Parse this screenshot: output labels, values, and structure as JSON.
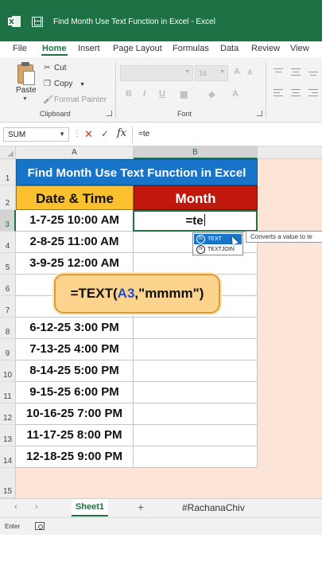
{
  "window": {
    "title": "Find Month Use Text Function in Excel  -  Excel"
  },
  "menu_tabs": [
    "File",
    "Home",
    "Insert",
    "Page Layout",
    "Formulas",
    "Data",
    "Review",
    "View"
  ],
  "ribbon": {
    "paste_label": "Paste",
    "cut_label": "Cut",
    "copy_label": "Copy",
    "format_painter_label": "Format Painter",
    "clipboard_group": "Clipboard",
    "font_group": "Font",
    "font_size": "16"
  },
  "formula_bar": {
    "name_box": "SUM",
    "content": "=te"
  },
  "columns": [
    "A",
    "B"
  ],
  "rows": [
    "1",
    "2",
    "3",
    "4",
    "5",
    "6",
    "7",
    "8",
    "9",
    "10",
    "11",
    "12",
    "13",
    "14",
    "15"
  ],
  "sheet": {
    "title": "Find Month Use Text Function in Excel",
    "header_a": "Date & Time",
    "header_b": "Month",
    "active_cell_text": "=te",
    "dates": [
      "1-7-25 10:00 AM",
      "2-8-25 11:00 AM",
      "3-9-25 12:00 AM",
      "4-10",
      "5-11",
      "6-12-25 3:00 PM",
      "7-13-25 4:00 PM",
      "8-14-25 5:00 PM",
      "9-15-25 6:00 PM",
      "10-16-25 7:00 PM",
      "11-17-25 8:00 PM",
      "12-18-25 9:00 PM"
    ]
  },
  "autocomplete": {
    "items": [
      "TEXT",
      "TEXTJOIN"
    ],
    "tooltip": "Converts a value to te"
  },
  "callout": {
    "prefix": "=TEXT(",
    "ref": "A3",
    "suffix": ",\"mmmm\")"
  },
  "sheet_tabs": {
    "active": "Sheet1",
    "handle": "#RachanaChiv"
  },
  "status": {
    "mode": "Enter"
  },
  "colors": {
    "excel_green": "#1e7145",
    "title_blue": "#1874c8",
    "header_yellow": "#fbc02d",
    "header_red": "#c0180c",
    "sheet_background": "#fce4d6",
    "callout_fill": "#fcd48e",
    "cell_ref_blue": "#1f4fd1"
  }
}
